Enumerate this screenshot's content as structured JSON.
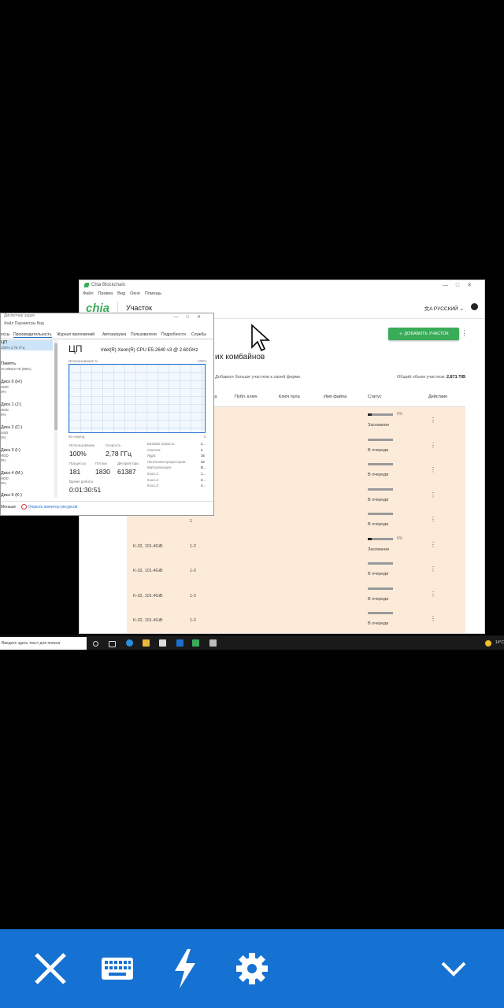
{
  "chia": {
    "window_title": "Chia Blockchain",
    "menu": [
      "Файл",
      "Правка",
      "Вид",
      "Окно",
      "Помощь"
    ],
    "logo": "chia",
    "page_title": "Участок",
    "language": "РУССКИЙ",
    "add_button": "ДОБАВИТЬ УЧАСТОК",
    "heading": "их комбайнов",
    "subtext": "3. Добавьте больше участков к своей ферме.",
    "total_label": "Общий объем участков:",
    "total_value": "2,871 TiB",
    "columns": [
      "да",
      "Публ. ключ",
      "Ключ пула",
      "Имя файла",
      "Статус",
      "Действие"
    ],
    "rows": [
      {
        "size": "",
        "queue": "",
        "status": "Засевание",
        "progress": 0.06,
        "pct": "6%"
      },
      {
        "size": "",
        "queue": "",
        "status": "В очереди",
        "progress": 0,
        "pct": ""
      },
      {
        "size": "",
        "queue": "",
        "status": "В очереди",
        "progress": 0,
        "pct": ""
      },
      {
        "size": "",
        "queue": "",
        "status": "В очереди",
        "progress": 0,
        "pct": ""
      },
      {
        "size": "",
        "queue": "1",
        "status": "В очереди",
        "progress": 0,
        "pct": ""
      },
      {
        "size": "K-32, 101.4GiB",
        "queue": "1-2",
        "status": "Засевание",
        "progress": 0.06,
        "pct": "6%"
      },
      {
        "size": "K-32, 101.4GiB",
        "queue": "1-2",
        "status": "В очереди",
        "progress": 0,
        "pct": ""
      },
      {
        "size": "K-32, 101.4GiB",
        "queue": "1-2",
        "status": "В очереди",
        "progress": 0,
        "pct": ""
      },
      {
        "size": "K-32, 101.4GiB",
        "queue": "1-2",
        "status": "В очереди",
        "progress": 0,
        "pct": ""
      }
    ]
  },
  "taskmgr": {
    "title": "Диспетчер задач",
    "menu": "Файл  Параметры  Вид",
    "tabs": [
      "ессы",
      "Производительность",
      "Журнал приложений",
      "Автозагрузка",
      "Пользователи",
      "Подробности",
      "Службы"
    ],
    "sidebar": [
      {
        "name": "ЦП",
        "detail": "100% 2,78 ГГц"
      },
      {
        "name": "Память",
        "detail": "37,8/55,8 ГБ (68%)"
      },
      {
        "name": "Диск 0 (H:)",
        "detail": "HDD",
        "detail2": "0%"
      },
      {
        "name": "Диск 1 (J:)",
        "detail": "HDD",
        "detail2": "0%"
      },
      {
        "name": "Диск 2 (C:)",
        "detail": "SSD",
        "detail2": "3%"
      },
      {
        "name": "Диск 3 (I:)",
        "detail": "HDD",
        "detail2": "0%"
      },
      {
        "name": "Диск 4 (M:)",
        "detail": "HDD",
        "detail2": "0%"
      },
      {
        "name": "Диск 5 (K:)",
        "detail": "",
        "detail2": ""
      }
    ],
    "cpu_title": "ЦП",
    "cpu_model": "Intel(R) Xeon(R) CPU E5-2640 v3 @ 2.60GHz",
    "graph_label": "Использование %",
    "graph_max": "100%",
    "graph_time": "60 секунд",
    "graph_zero": "0",
    "usage_label": "Использование",
    "usage_value": "100%",
    "speed_label": "Скорость",
    "speed_value": "2,78 ГГц",
    "proc_label": "Процессы",
    "proc_value": "181",
    "threads_label": "Потоки",
    "threads_value": "1830",
    "handles_label": "Дескрипторы",
    "handles_value": "61387",
    "uptime_label": "Время работы",
    "uptime_value": "0:01:30:51",
    "details": [
      {
        "k": "Базовая скорость:",
        "v": "2..."
      },
      {
        "k": "Сокетов:",
        "v": "2"
      },
      {
        "k": "Ядра:",
        "v": "16"
      },
      {
        "k": "Логических процессоров:",
        "v": "32"
      },
      {
        "k": "Виртуализация:",
        "v": "В..."
      },
      {
        "k": "Кэш L1:",
        "v": "1..."
      },
      {
        "k": "Кэш L2:",
        "v": "4..."
      },
      {
        "k": "Кэш L3:",
        "v": "4..."
      }
    ],
    "less_label": "Меньше",
    "open_monitor": "Открыть монитор ресурсов"
  },
  "taskbar": {
    "search_placeholder": "Введите здесь текст для поиска",
    "tray_text": "14°C"
  },
  "toolbar": {
    "icons": [
      "close-icon",
      "keyboard-icon",
      "lightning-icon",
      "settings-icon",
      "chevron-down-icon"
    ]
  },
  "colors": {
    "chia_green": "#3aac59",
    "toolbar_blue": "#1672d2",
    "row_bg": "#fdebd9"
  }
}
